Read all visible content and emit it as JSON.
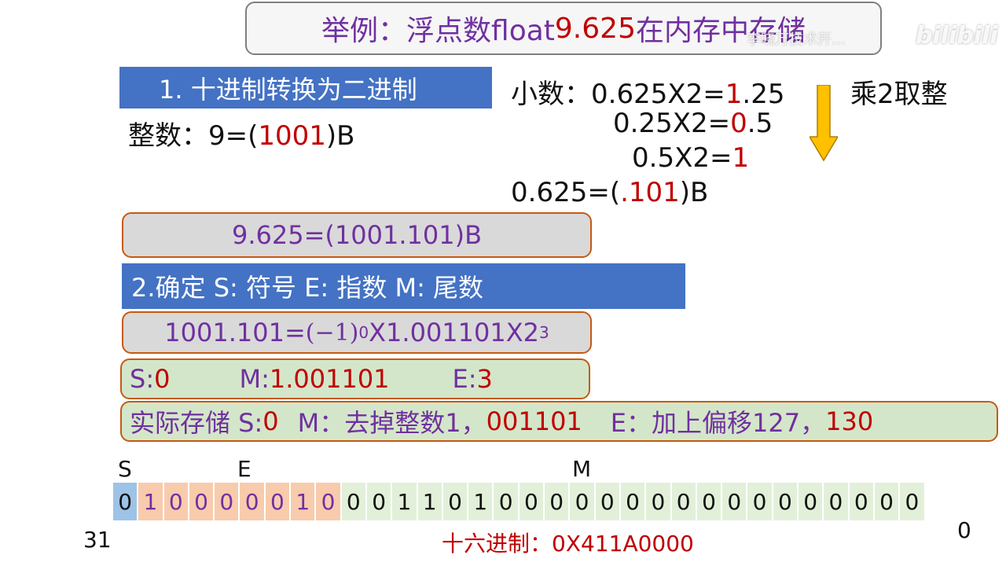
{
  "title": {
    "prefix": "举例：浮点数float ",
    "number": "9.625",
    "suffix": " 在内存中存储"
  },
  "watermark": {
    "text": "李晓万技术开… ",
    "logo": "bilibili"
  },
  "step1": {
    "label": "1. 十进制转换为二进制"
  },
  "integer_part": {
    "prefix": "整数：9=(",
    "digits": "1001",
    "suffix": ")B"
  },
  "fraction_steps": [
    {
      "lead": "小数：",
      "expr": "0.625X2=",
      "int_digit": "1",
      "rest": ".25"
    },
    {
      "lead": "",
      "expr": "0.25X2=",
      "int_digit": "0",
      "rest": ".5"
    },
    {
      "lead": "",
      "expr": "0.5X2=",
      "int_digit": "1",
      "rest": ""
    }
  ],
  "fraction_result": {
    "prefix": "0.625=(",
    "digits": ".101",
    "suffix": ")B"
  },
  "method_label": "乘2取整",
  "binary_value": "9.625=(1001.101)B",
  "step2": {
    "label": "2.确定  S: 符号  E: 指数  M: 尾数"
  },
  "normalized": {
    "lhs": "1001.101=",
    "sign_term": "(−1)",
    "sign_exp": "0",
    "mid": "X1.001101X2",
    "exp": "3"
  },
  "sme": {
    "s_label": "S: ",
    "s_value": "0",
    "m_label": "M: ",
    "m_value": "1.001101",
    "e_label": "E: ",
    "e_value": "3"
  },
  "storage": {
    "prefix": "实际存储 S: ",
    "s_value": "0",
    "m_label": "M：去掉整数1，",
    "m_value": "001101",
    "e_label": "E：加上偏移127，",
    "e_value": "130"
  },
  "fields": {
    "s": "S",
    "e": "E",
    "m": "M"
  },
  "bits": {
    "sign": [
      "0"
    ],
    "exponent": [
      "1",
      "0",
      "0",
      "0",
      "0",
      "0",
      "1",
      "0"
    ],
    "mantissa": [
      "0",
      "0",
      "1",
      "1",
      "0",
      "1",
      "0",
      "0",
      "0",
      "0",
      "0",
      "0",
      "0",
      "0",
      "0",
      "0",
      "0",
      "0",
      "0",
      "0",
      "0",
      "0",
      "0"
    ]
  },
  "bit_index_high": "31",
  "bit_index_low": "0",
  "hex": {
    "label": "十六进制：",
    "value": "0X411A0000"
  },
  "colors": {
    "accent_blue": "#4472c4",
    "highlight_red": "#c00000",
    "text_purple": "#7030a0",
    "arrow_yellow": "#ffc000"
  }
}
